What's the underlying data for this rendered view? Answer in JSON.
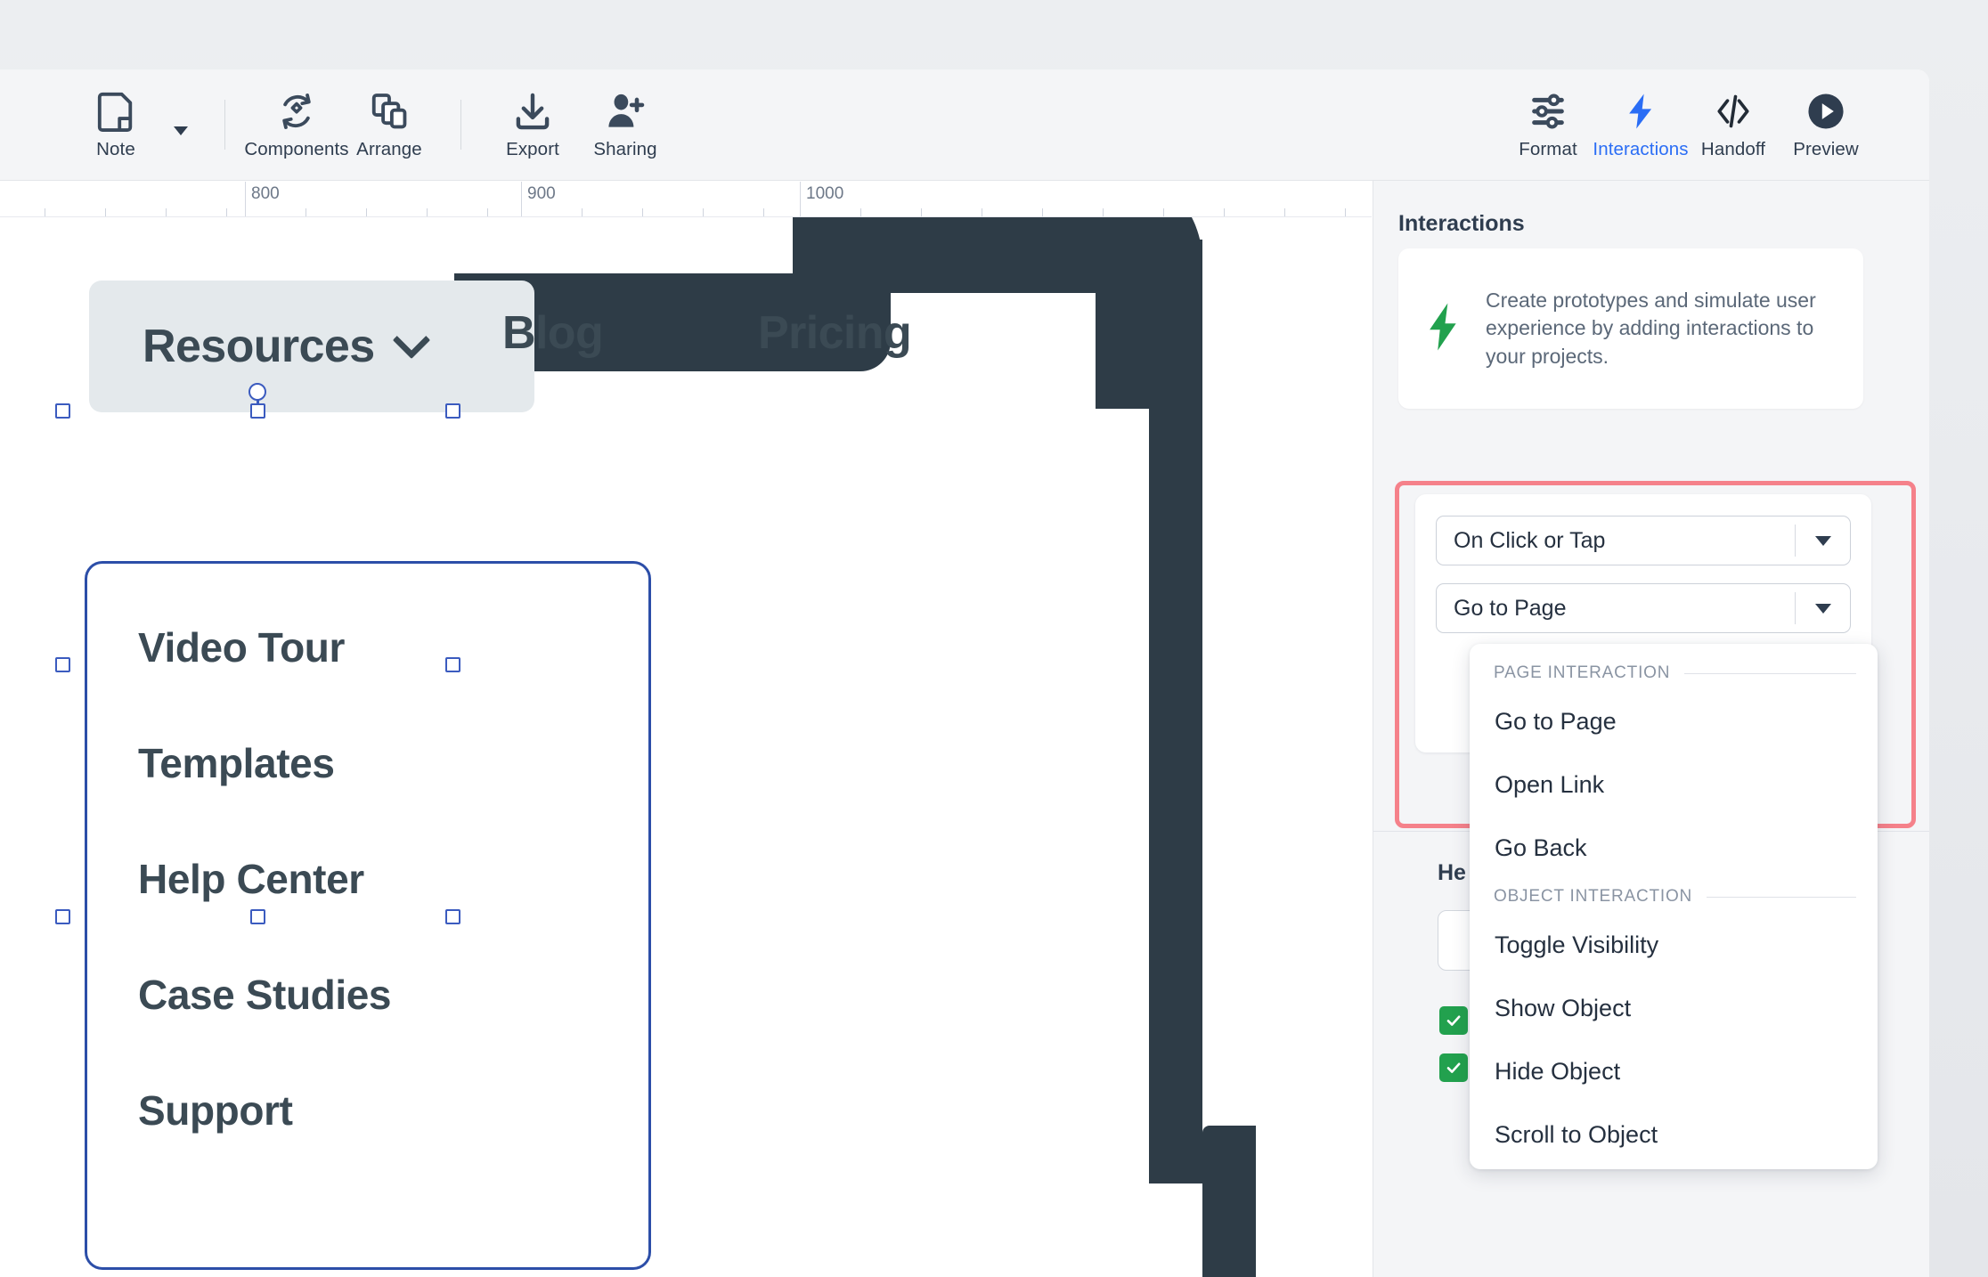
{
  "app": {
    "accent_blue": "#2a6df5",
    "accent_green": "#22a14e",
    "highlight_red": "#f5818a",
    "selection_blue": "#2c4ea8",
    "dark_ink": "#2f3d4f"
  },
  "toolbar": {
    "left_items": [
      {
        "label": "Note",
        "icon": "note-icon",
        "has_caret": true
      },
      {
        "label": "Components",
        "icon": "components-icon",
        "has_caret": false
      },
      {
        "label": "Arrange",
        "icon": "arrange-icon",
        "has_caret": false
      },
      {
        "label": "Export",
        "icon": "export-icon",
        "has_caret": false
      },
      {
        "label": "Sharing",
        "icon": "sharing-icon",
        "has_caret": false
      }
    ],
    "right_items": [
      {
        "label": "Format",
        "icon": "sliders-icon",
        "active": false
      },
      {
        "label": "Interactions",
        "icon": "bolt-icon",
        "active": true
      },
      {
        "label": "Handoff",
        "icon": "code-icon",
        "active": false
      },
      {
        "label": "Preview",
        "icon": "play-icon",
        "active": false
      }
    ]
  },
  "ruler": {
    "labels": [
      "800",
      "900",
      "1000"
    ]
  },
  "canvas": {
    "nav": {
      "resources_label": "Resources",
      "blog_label": "Blog",
      "pricing_label": "Pricing"
    },
    "dropdown_items": [
      "Video Tour",
      "Templates",
      "Help Center",
      "Case Studies",
      "Support"
    ]
  },
  "panel": {
    "title": "Interactions",
    "info_card": {
      "icon": "bolt-icon",
      "text": "Create prototypes and simulate user experience by adding interactions to your projects."
    },
    "trigger_select": {
      "label": "trigger",
      "value": "On Click or Tap"
    },
    "action_select": {
      "label": "action",
      "value": "Go to Page"
    },
    "section_two": {
      "title_visible": "He",
      "field_value": "",
      "checkbox_one_checked": true,
      "checkbox_two_checked": true
    }
  },
  "dropdown_menu": {
    "groups": [
      {
        "heading": "PAGE INTERACTION",
        "items": [
          "Go to Page",
          "Open Link",
          "Go Back"
        ]
      },
      {
        "heading": "OBJECT INTERACTION",
        "items": [
          "Toggle Visibility",
          "Show Object",
          "Hide Object",
          "Scroll to Object"
        ]
      }
    ]
  }
}
